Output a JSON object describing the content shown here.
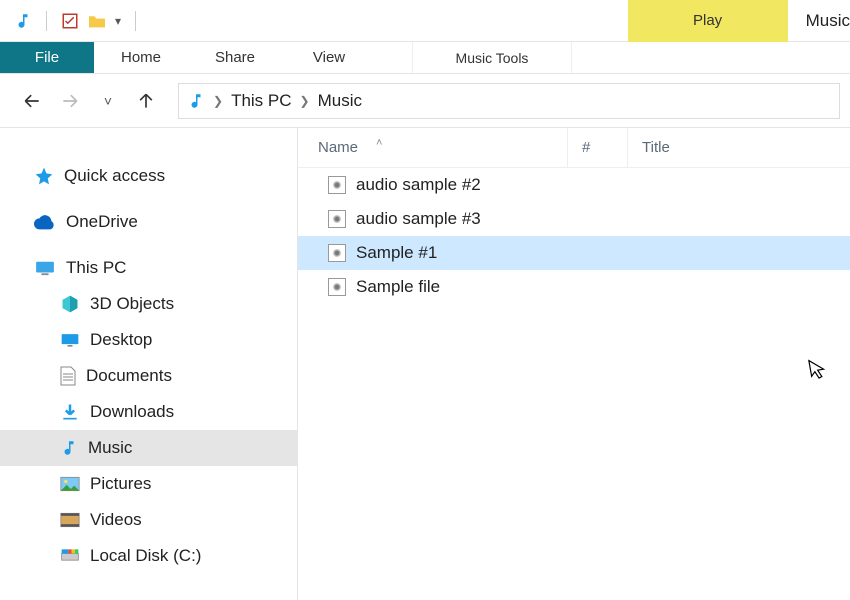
{
  "titlebar": {
    "context_tab": "Play",
    "window_title": "Music"
  },
  "ribbon": {
    "file": "File",
    "tabs": [
      "Home",
      "Share",
      "View"
    ],
    "context_tab": "Music Tools"
  },
  "breadcrumb": {
    "segments": [
      "This PC",
      "Music"
    ]
  },
  "nav": {
    "quick_access": "Quick access",
    "onedrive": "OneDrive",
    "this_pc": "This PC",
    "children": [
      "3D Objects",
      "Desktop",
      "Documents",
      "Downloads",
      "Music",
      "Pictures",
      "Videos",
      "Local Disk (C:)"
    ],
    "selected": "Music"
  },
  "columns": {
    "name": "Name",
    "number": "#",
    "title": "Title"
  },
  "files": [
    {
      "name": "audio sample #2",
      "selected": false
    },
    {
      "name": "audio sample #3",
      "selected": false
    },
    {
      "name": "Sample #1",
      "selected": true
    },
    {
      "name": "Sample file",
      "selected": false
    }
  ]
}
